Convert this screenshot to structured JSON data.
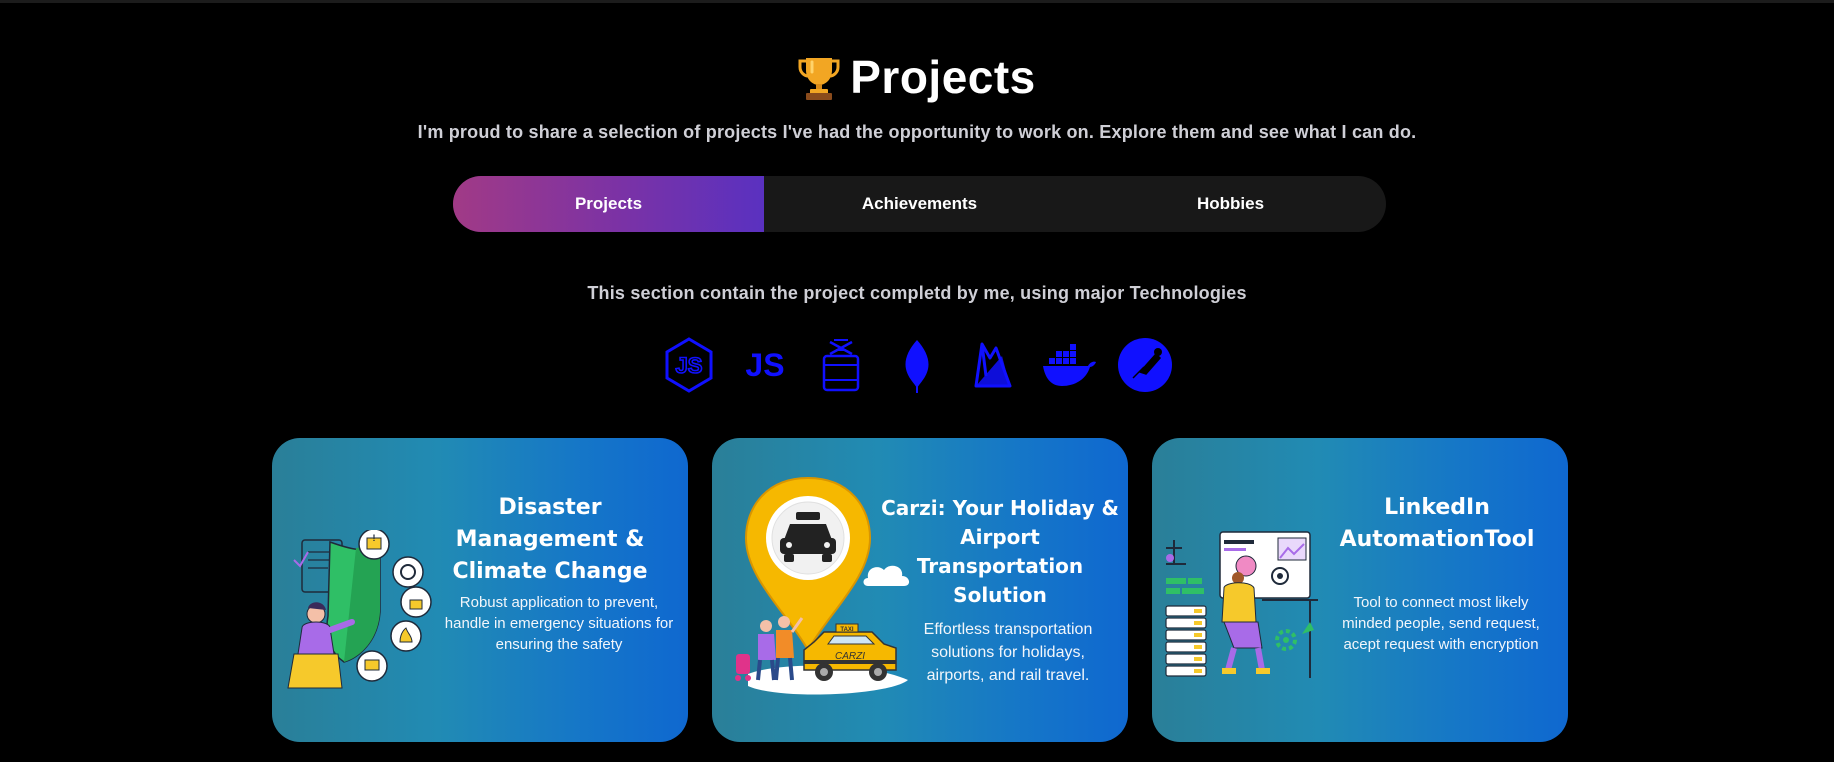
{
  "header": {
    "title": "Projects",
    "trophy_icon": "trophy-icon",
    "subtitle": "I'm proud to share a selection of projects I've had the opportunity to work on. Explore them and see what I can do."
  },
  "tabs": [
    {
      "label": "Projects",
      "active": true
    },
    {
      "label": "Achievements",
      "active": false
    },
    {
      "label": "Hobbies",
      "active": false
    }
  ],
  "section": {
    "description": "This section contain the project completd by me, using major Technologies"
  },
  "technologies": [
    {
      "name": "nodejs-icon"
    },
    {
      "name": "javascript-icon"
    },
    {
      "name": "postman-box-icon"
    },
    {
      "name": "mongodb-icon"
    },
    {
      "name": "firebase-icon"
    },
    {
      "name": "docker-icon"
    },
    {
      "name": "postman-icon"
    }
  ],
  "colors": {
    "background": "#000000",
    "tech_icon": "#1010ff",
    "tab_active_start": "#a13a86",
    "tab_active_end": "#5a31c0",
    "card_start": "#2a7f98",
    "card_end": "#0f68d0"
  },
  "projects": [
    {
      "title": "Disaster Management & Climate Change",
      "description": "Robust application to prevent, handle in emergency situations for ensuring the safety",
      "illustration": "security-shield-illustration"
    },
    {
      "title": "Carzi: Your Holiday & Airport Transportation Solution",
      "description": "Effortless transportation solutions for holidays, airports, and rail travel.",
      "illustration": "taxi-location-pin-illustration",
      "taxi_text": "CARZI",
      "roof_sign": "TAXI"
    },
    {
      "title": "LinkedIn AutomationTool",
      "description": "Tool to connect most likely minded people, send request, acept request with encryption",
      "illustration": "automation-workstation-illustration"
    }
  ]
}
